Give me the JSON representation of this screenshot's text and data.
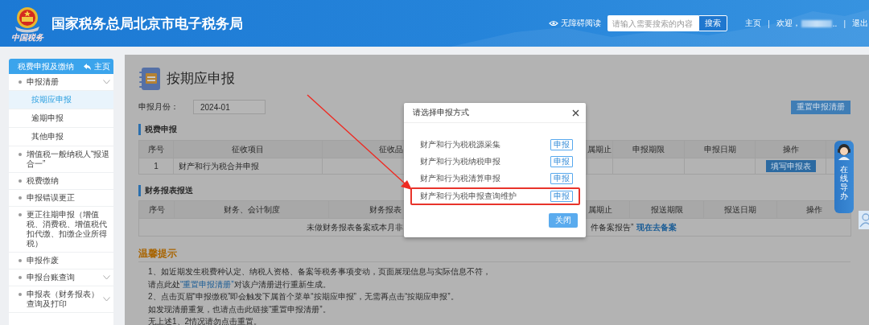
{
  "header": {
    "site_title": "国家税务总局北京市电子税务局",
    "emblem_caption": "中国税务",
    "accessibility": "无障碍阅读",
    "search": {
      "placeholder": "请输入需要搜索的内容",
      "button": "搜索"
    },
    "nav": [
      {
        "kind": "link",
        "text": "主页"
      },
      {
        "kind": "separator",
        "text": "|"
      },
      {
        "kind": "welcome",
        "text": "欢迎，",
        "suffix": ".."
      },
      {
        "kind": "separator",
        "text": "|"
      },
      {
        "kind": "link",
        "text": "退出"
      }
    ]
  },
  "sidebar": {
    "title": "税费申报及缴纳",
    "home_link": "主页",
    "items": [
      {
        "kind": "group",
        "label": "申报清册",
        "selected": false,
        "children": [
          {
            "label": "按期应申报",
            "selected": true
          },
          {
            "label": "逾期申报",
            "selected": false
          },
          {
            "label": "其他申报",
            "selected": false
          }
        ]
      },
      {
        "kind": "link",
        "label": "增值税一般纳税人“报退合一”",
        "selected": false
      },
      {
        "kind": "link",
        "label": "税费缴纳",
        "selected": false
      },
      {
        "kind": "link",
        "label": "申报错误更正",
        "selected": false
      },
      {
        "kind": "link",
        "label": "更正往期申报（增值税、消费税、增值税代扣代缴、扣缴企业所得税）",
        "selected": false
      },
      {
        "kind": "link",
        "label": "申报作废",
        "selected": false
      },
      {
        "kind": "group",
        "label": "申报台账查询",
        "selected": false
      },
      {
        "kind": "group",
        "label": "申报表（财务报表）查询及打印",
        "selected": false
      }
    ]
  },
  "page": {
    "title": "按期应申报",
    "month_label": "申报月份：",
    "month_value": "2024-01",
    "reset_button": "重置申报清册",
    "sections": [
      {
        "heading": "税费申报",
        "columns": [
          "序号",
          "征收项目",
          "征收品",
          "属期止",
          "申报期限",
          "申报日期",
          "操作"
        ],
        "rows": [
          {
            "cells": [
              "1",
              "财产和行为税合并申报"
            ],
            "action": "填写申报表"
          }
        ]
      },
      {
        "heading": "财务报表报送",
        "columns": [
          "序号",
          "财务、会计制度",
          "财务报表",
          "属期止",
          "报送期限",
          "报送日期",
          "操作"
        ],
        "notice": {
          "text_start": "未做财务报表备案或本月非",
          "text_end": "件备案报告”",
          "link": "现在去备案"
        }
      }
    ],
    "tips": {
      "title": "温馨提示",
      "lines": [
        {
          "text": "1、如近期发生税费种认定、纳税人资格、备案等税务事项变动，页面展现信息与实际信息不符，"
        },
        {
          "text": "请点此处",
          "link": "“重置申报清册”",
          "after": "对该户清册进行重新生成。"
        },
        {
          "text": "2、点击页眉“申报缴税”即会触发下属首个菜单“按期应申报”，无需再点击“按期应申报”。"
        },
        {
          "text": "如发现清册重复，也请点击此链接“重置申报清册”。"
        },
        {
          "text": "无上述1、2情况请勿点击重置。"
        }
      ]
    }
  },
  "dialog": {
    "title": "请选择申报方式",
    "options": [
      {
        "label": "财产和行为税税源采集",
        "button": "申报",
        "highlighted": false
      },
      {
        "label": "财产和行为税纳税申报",
        "button": "申报",
        "highlighted": false
      },
      {
        "label": "财产和行为税清算申报",
        "button": "申报",
        "highlighted": false
      },
      {
        "label": "财产和行为税申报查询维护",
        "button": "申报",
        "highlighted": true
      }
    ],
    "close_button": "关闭"
  },
  "guide_widget": {
    "label": "在线导办"
  }
}
